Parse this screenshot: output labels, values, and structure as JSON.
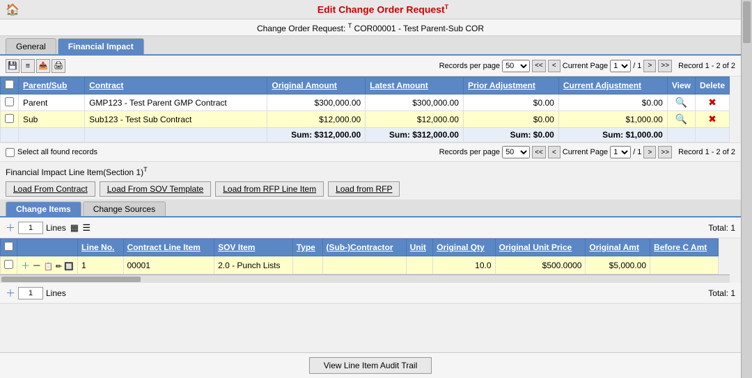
{
  "header": {
    "title": "Edit Change Order Request",
    "title_superscript": "T",
    "subtitle_prefix": "Change Order Request:",
    "subtitle_superscript": "T",
    "subtitle_value": "COR00001 - Test Parent-Sub COR"
  },
  "tabs": {
    "general_label": "General",
    "financial_impact_label": "Financial Impact"
  },
  "toolbar": {
    "records_per_page_label": "Records per page",
    "records_per_page_value": "50",
    "current_page_label": "Current Page",
    "current_page_value": "1",
    "total_pages": "1",
    "record_count": "Record 1 - 2 of 2"
  },
  "table_headers": {
    "checkbox": "",
    "parent_sub": "Parent/Sub",
    "contract": "Contract",
    "original_amount": "Original Amount",
    "latest_amount": "Latest Amount",
    "prior_adjustment": "Prior Adjustment",
    "current_adjustment": "Current Adjustment",
    "view": "View",
    "delete": "Delete"
  },
  "table_rows": [
    {
      "id": "1",
      "parent_sub": "Parent",
      "contract": "GMP123 - Test Parent GMP Contract",
      "original_amount": "$300,000.00",
      "latest_amount": "$300,000.00",
      "prior_adjustment": "$0.00",
      "current_adjustment": "$0.00"
    },
    {
      "id": "2",
      "parent_sub": "Sub",
      "contract": "Sub123 - Test Sub Contract",
      "original_amount": "$12,000.00",
      "latest_amount": "$12,000.00",
      "prior_adjustment": "$0.00",
      "current_adjustment": "$1,000.00"
    }
  ],
  "sum_row": {
    "original_amount": "Sum: $312,000.00",
    "latest_amount": "Sum: $312,000.00",
    "prior_adjustment": "Sum: $0.00",
    "current_adjustment": "Sum: $1,000.00"
  },
  "bottom_pagination": {
    "select_all_label": "Select all found records",
    "records_per_page_label": "Records per page",
    "records_per_page_value": "50",
    "current_page_label": "Current Page",
    "current_page_value": "1",
    "total_pages": "1",
    "record_count": "Record 1 - 2 of 2"
  },
  "section_title": "Financial Impact Line Item(Section 1)",
  "section_superscript": "T",
  "action_buttons": {
    "load_from_contract": "Load From Contract",
    "load_from_sov_template": "Load From SOV Template",
    "load_from_rfp_line_item": "Load from RFP Line Item",
    "load_from_rfp": "Load from RFP"
  },
  "sub_tabs": {
    "change_items": "Change Items",
    "change_sources": "Change Sources"
  },
  "inner_toolbar": {
    "lines_value": "1",
    "lines_label": "Lines",
    "total": "Total: 1"
  },
  "detail_table_headers": {
    "checkbox": "",
    "actions": "",
    "line_no": "Line No.",
    "contract_line_item": "Contract Line Item",
    "sov_item": "SOV Item",
    "type": "Type",
    "sub_contractor": "(Sub-)Contractor",
    "unit": "Unit",
    "original_qty": "Original Qty",
    "original_unit_price": "Original Unit Price",
    "original_amt": "Original Amt",
    "before_c_amt": "Before C Amt"
  },
  "detail_rows": [
    {
      "line_no": "1",
      "contract_line_item": "00001",
      "sov_item": "2.0 - Punch Lists",
      "type": "",
      "sub_contractor": "",
      "unit": "",
      "original_qty": "10.0",
      "original_unit_price": "$500.0000",
      "original_amt": "$5,000.00",
      "before_c_amt": ""
    }
  ],
  "bottom_inner_toolbar": {
    "lines_value": "1",
    "lines_label": "Lines",
    "total": "Total: 1"
  },
  "footer": {
    "audit_btn": "View Line Item Audit Trail"
  }
}
